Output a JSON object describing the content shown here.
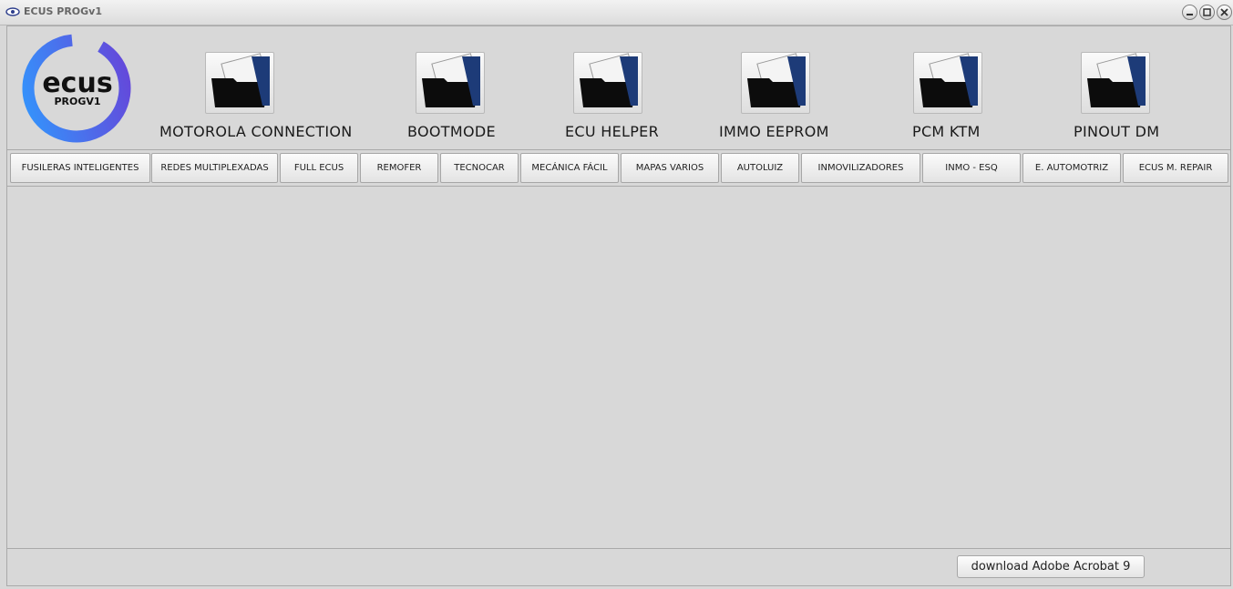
{
  "window": {
    "title": "ECUS PROGv1"
  },
  "logo": {
    "brand": "ecus",
    "sub": "PROGV1",
    "ring_color": "#5a4bd8",
    "ring_color_2": "#2f9bff"
  },
  "tools": [
    {
      "label": "MOTOROLA CONNECTION",
      "icon": "folder-document-icon"
    },
    {
      "label": "BOOTMODE",
      "icon": "folder-document-icon"
    },
    {
      "label": "ECU HELPER",
      "icon": "folder-document-icon"
    },
    {
      "label": "IMMO EEPROM",
      "icon": "folder-document-icon"
    },
    {
      "label": "PCM KTM",
      "icon": "folder-document-icon"
    },
    {
      "label": "PINOUT DM",
      "icon": "folder-document-icon"
    }
  ],
  "tabs": [
    "FUSILERAS INTELIGENTES",
    "REDES MULTIPLEXADAS",
    "FULL ECUS",
    "REMOFER",
    "TECNOCAR",
    "MECÁNICA FÁCIL",
    "MAPAS VARIOS",
    "AUTOLUIZ",
    "INMOVILIZADORES",
    "INMO - ESQ",
    "E. AUTOMOTRIZ",
    "ECUS M. REPAIR"
  ],
  "footer": {
    "download_label": "download Adobe Acrobat 9"
  }
}
